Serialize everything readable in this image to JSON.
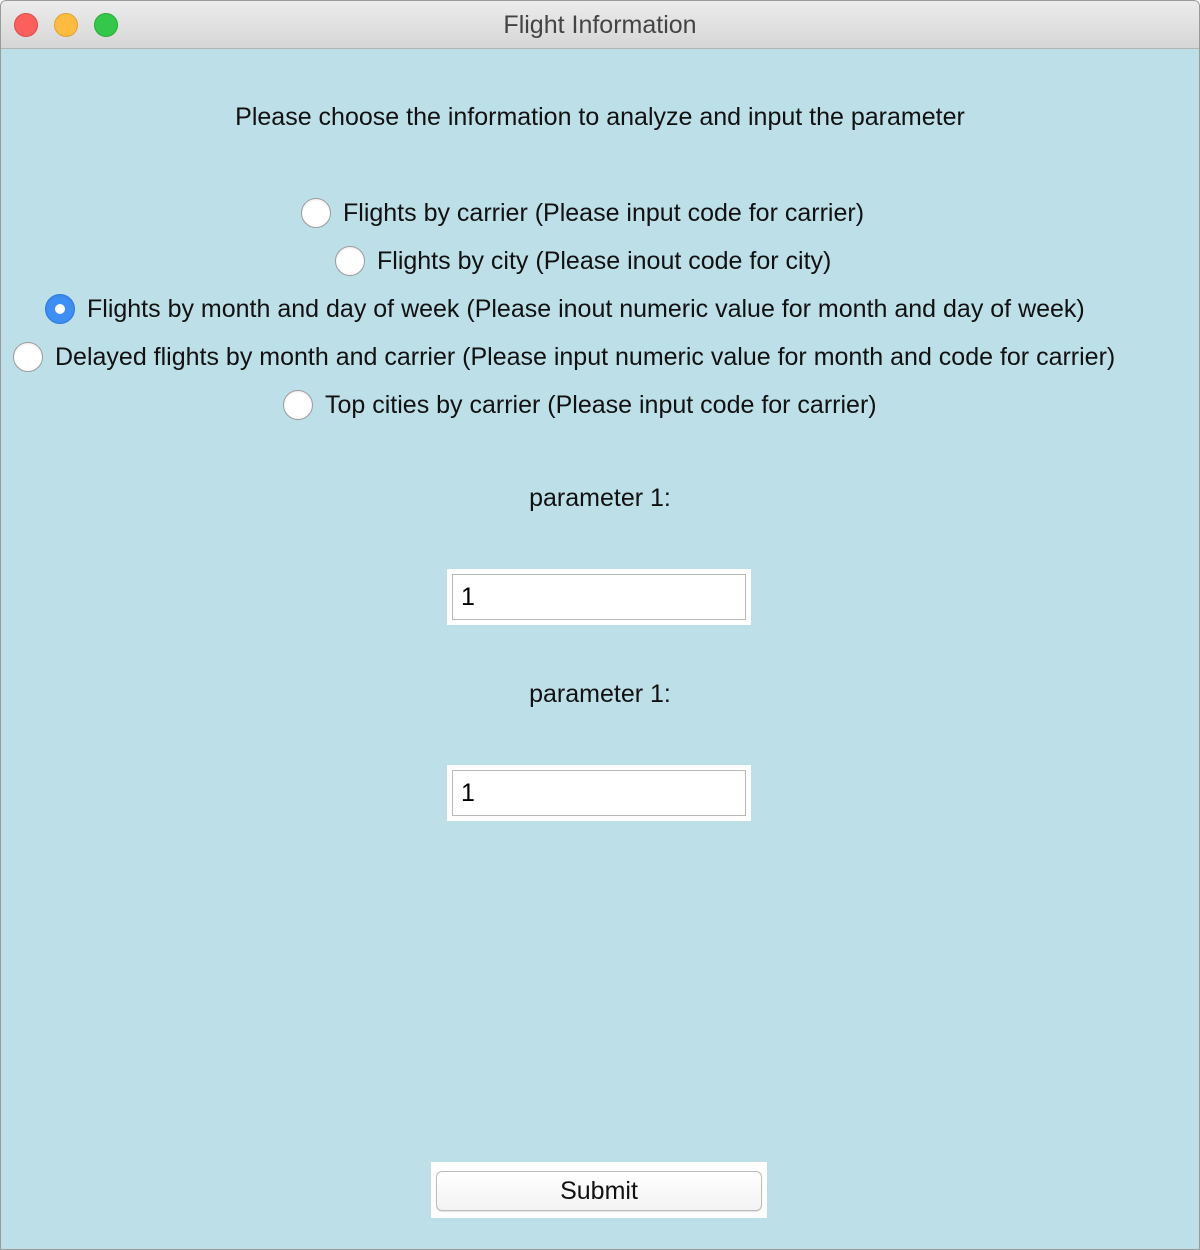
{
  "window": {
    "title": "Flight Information"
  },
  "instruction": "Please choose the information to analyze and input the parameter",
  "options": [
    {
      "label": "Flights by carrier (Please input code for carrier)",
      "selected": false
    },
    {
      "label": "Flights by city (Please inout code for city)",
      "selected": false
    },
    {
      "label": "Flights by month and day of week (Please inout numeric value for month and day of week)",
      "selected": true
    },
    {
      "label": "Delayed flights by month and carrier (Please input numeric value for month and code for carrier)",
      "selected": false
    },
    {
      "label": "Top cities by carrier (Please input code for carrier)",
      "selected": false
    }
  ],
  "parameters": [
    {
      "label": "parameter 1:",
      "value": "1"
    },
    {
      "label": "parameter 1:",
      "value": "1"
    }
  ],
  "submit_label": "Submit",
  "colors": {
    "background": "#bcdfe8",
    "radio_selected": "#3d8ef5",
    "close": "#fc605c",
    "minimize": "#fdbc40",
    "maximize": "#34c84a"
  },
  "icons": {
    "close": "close-icon",
    "minimize": "minimize-icon",
    "maximize": "maximize-icon",
    "radio_selected": "radio-selected-icon",
    "radio_unselected": "radio-unselected-icon"
  }
}
